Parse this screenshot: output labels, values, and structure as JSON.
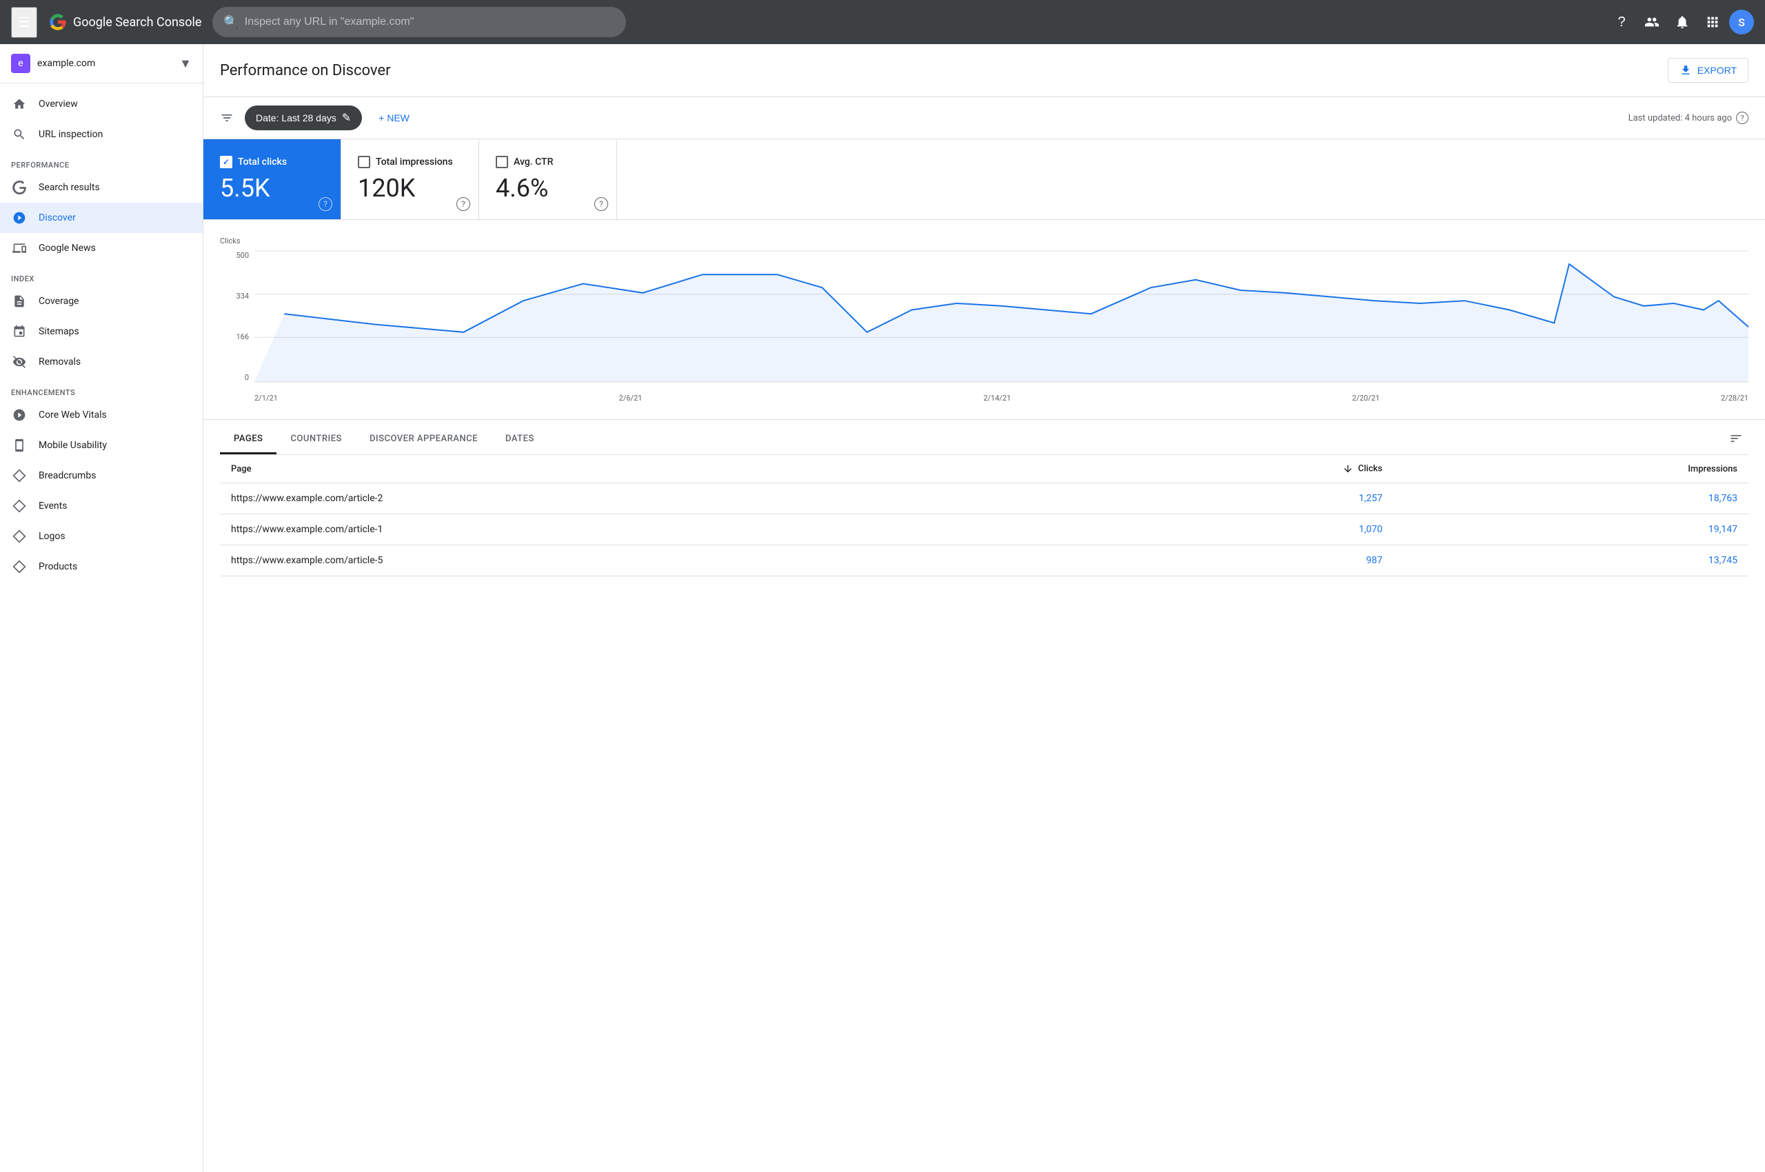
{
  "topnav": {
    "logo": "Google Search Console",
    "search_placeholder": "Inspect any URL in \"example.com\"",
    "avatar_letter": "S"
  },
  "sidebar": {
    "property": {
      "name": "example.com",
      "icon_letter": "e"
    },
    "nav": [
      {
        "id": "overview",
        "label": "Overview",
        "icon": "home",
        "section": null,
        "active": false
      },
      {
        "id": "url-inspection",
        "label": "URL inspection",
        "icon": "search",
        "section": null,
        "active": false
      },
      {
        "id": "performance-section-label",
        "label": "PERFORMANCE",
        "type": "section"
      },
      {
        "id": "search-results",
        "label": "Search results",
        "icon": "google",
        "section": "Performance",
        "active": false
      },
      {
        "id": "discover",
        "label": "Discover",
        "icon": "asterisk",
        "section": "Performance",
        "active": true
      },
      {
        "id": "google-news",
        "label": "Google News",
        "icon": "news",
        "section": "Performance",
        "active": false
      },
      {
        "id": "index-section-label",
        "label": "INDEX",
        "type": "section"
      },
      {
        "id": "coverage",
        "label": "Coverage",
        "icon": "doc",
        "section": "Index",
        "active": false
      },
      {
        "id": "sitemaps",
        "label": "Sitemaps",
        "icon": "sitemap",
        "section": "Index",
        "active": false
      },
      {
        "id": "removals",
        "label": "Removals",
        "icon": "eye-off",
        "section": "Index",
        "active": false
      },
      {
        "id": "enhancements-section-label",
        "label": "ENHANCEMENTS",
        "type": "section"
      },
      {
        "id": "core-web-vitals",
        "label": "Core Web Vitals",
        "icon": "gauge",
        "section": "Enhancements",
        "active": false
      },
      {
        "id": "mobile-usability",
        "label": "Mobile Usability",
        "icon": "mobile",
        "section": "Enhancements",
        "active": false
      },
      {
        "id": "breadcrumbs",
        "label": "Breadcrumbs",
        "icon": "diamond",
        "section": "Enhancements",
        "active": false
      },
      {
        "id": "events",
        "label": "Events",
        "icon": "diamond",
        "section": "Enhancements",
        "active": false
      },
      {
        "id": "logos",
        "label": "Logos",
        "icon": "diamond",
        "section": "Enhancements",
        "active": false
      },
      {
        "id": "products",
        "label": "Products",
        "icon": "diamond",
        "section": "Enhancements",
        "active": false
      }
    ]
  },
  "page": {
    "title": "Performance on Discover",
    "export_label": "EXPORT",
    "filter": {
      "date_label": "Date: Last 28 days",
      "new_label": "+ NEW"
    },
    "last_updated": "Last updated: 4 hours ago"
  },
  "metrics": [
    {
      "id": "total-clicks",
      "label": "Total clicks",
      "value": "5.5K",
      "active": true
    },
    {
      "id": "total-impressions",
      "label": "Total impressions",
      "value": "120K",
      "active": false
    },
    {
      "id": "avg-ctr",
      "label": "Avg. CTR",
      "value": "4.6%",
      "active": false
    }
  ],
  "chart": {
    "y_label": "Clicks",
    "y_ticks": [
      "500",
      "334",
      "166",
      "0"
    ],
    "x_ticks": [
      "2/1/21",
      "2/6/21",
      "2/14/21",
      "2/20/21",
      "2/28/21"
    ],
    "data_points": [
      {
        "x": 0.02,
        "y": 0.52
      },
      {
        "x": 0.08,
        "y": 0.44
      },
      {
        "x": 0.14,
        "y": 0.38
      },
      {
        "x": 0.18,
        "y": 0.62
      },
      {
        "x": 0.22,
        "y": 0.75
      },
      {
        "x": 0.26,
        "y": 0.68
      },
      {
        "x": 0.3,
        "y": 0.82
      },
      {
        "x": 0.35,
        "y": 0.82
      },
      {
        "x": 0.38,
        "y": 0.72
      },
      {
        "x": 0.41,
        "y": 0.38
      },
      {
        "x": 0.44,
        "y": 0.55
      },
      {
        "x": 0.47,
        "y": 0.6
      },
      {
        "x": 0.5,
        "y": 0.58
      },
      {
        "x": 0.53,
        "y": 0.55
      },
      {
        "x": 0.56,
        "y": 0.52
      },
      {
        "x": 0.6,
        "y": 0.72
      },
      {
        "x": 0.63,
        "y": 0.78
      },
      {
        "x": 0.66,
        "y": 0.7
      },
      {
        "x": 0.69,
        "y": 0.68
      },
      {
        "x": 0.72,
        "y": 0.65
      },
      {
        "x": 0.75,
        "y": 0.62
      },
      {
        "x": 0.78,
        "y": 0.6
      },
      {
        "x": 0.81,
        "y": 0.62
      },
      {
        "x": 0.84,
        "y": 0.55
      },
      {
        "x": 0.87,
        "y": 0.45
      },
      {
        "x": 0.88,
        "y": 0.9
      },
      {
        "x": 0.91,
        "y": 0.65
      },
      {
        "x": 0.93,
        "y": 0.58
      },
      {
        "x": 0.95,
        "y": 0.6
      },
      {
        "x": 0.97,
        "y": 0.55
      },
      {
        "x": 0.98,
        "y": 0.62
      },
      {
        "x": 1.0,
        "y": 0.42
      }
    ]
  },
  "tabs": [
    {
      "id": "pages",
      "label": "PAGES",
      "active": true
    },
    {
      "id": "countries",
      "label": "COUNTRIES",
      "active": false
    },
    {
      "id": "discover-appearance",
      "label": "DISCOVER APPEARANCE",
      "active": false
    },
    {
      "id": "dates",
      "label": "DATES",
      "active": false
    }
  ],
  "table": {
    "columns": [
      {
        "id": "page",
        "label": "Page",
        "numeric": false
      },
      {
        "id": "clicks",
        "label": "Clicks",
        "numeric": true,
        "sort": true
      },
      {
        "id": "impressions",
        "label": "Impressions",
        "numeric": true
      }
    ],
    "rows": [
      {
        "page": "https://www.example.com/article-2",
        "clicks": "1,257",
        "impressions": "18,763"
      },
      {
        "page": "https://www.example.com/article-1",
        "clicks": "1,070",
        "impressions": "19,147"
      },
      {
        "page": "https://www.example.com/article-5",
        "clicks": "987",
        "impressions": "13,745"
      }
    ]
  }
}
